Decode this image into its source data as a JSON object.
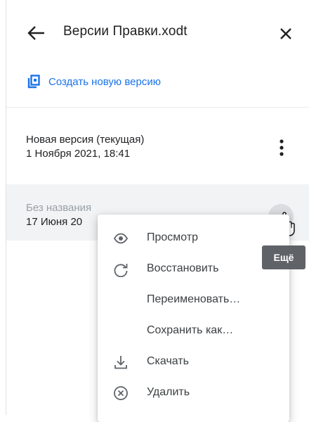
{
  "header": {
    "title": "Версии Правки.xodt",
    "back_icon": "arrow-left-icon",
    "close_icon": "close-icon"
  },
  "create_version": {
    "label": "Создать новую версию",
    "icon": "copy-icon",
    "accent_color": "#1a73e8"
  },
  "versions": [
    {
      "name": "Новая версия (текущая)",
      "date": "1 Ноября 2021, 18:41"
    },
    {
      "name": "Без названия",
      "date": "17 Июня 20"
    }
  ],
  "tooltip": {
    "text": "Ещё"
  },
  "context_menu": {
    "items": [
      {
        "label": "Просмотр",
        "icon": "eye-icon"
      },
      {
        "label": "Восстановить",
        "icon": "restore-icon"
      },
      {
        "label": "Переименовать…",
        "icon": ""
      },
      {
        "label": "Сохранить как…",
        "icon": ""
      },
      {
        "label": "Скачать",
        "icon": "download-icon"
      },
      {
        "label": "Удалить",
        "icon": "delete-icon"
      }
    ]
  }
}
